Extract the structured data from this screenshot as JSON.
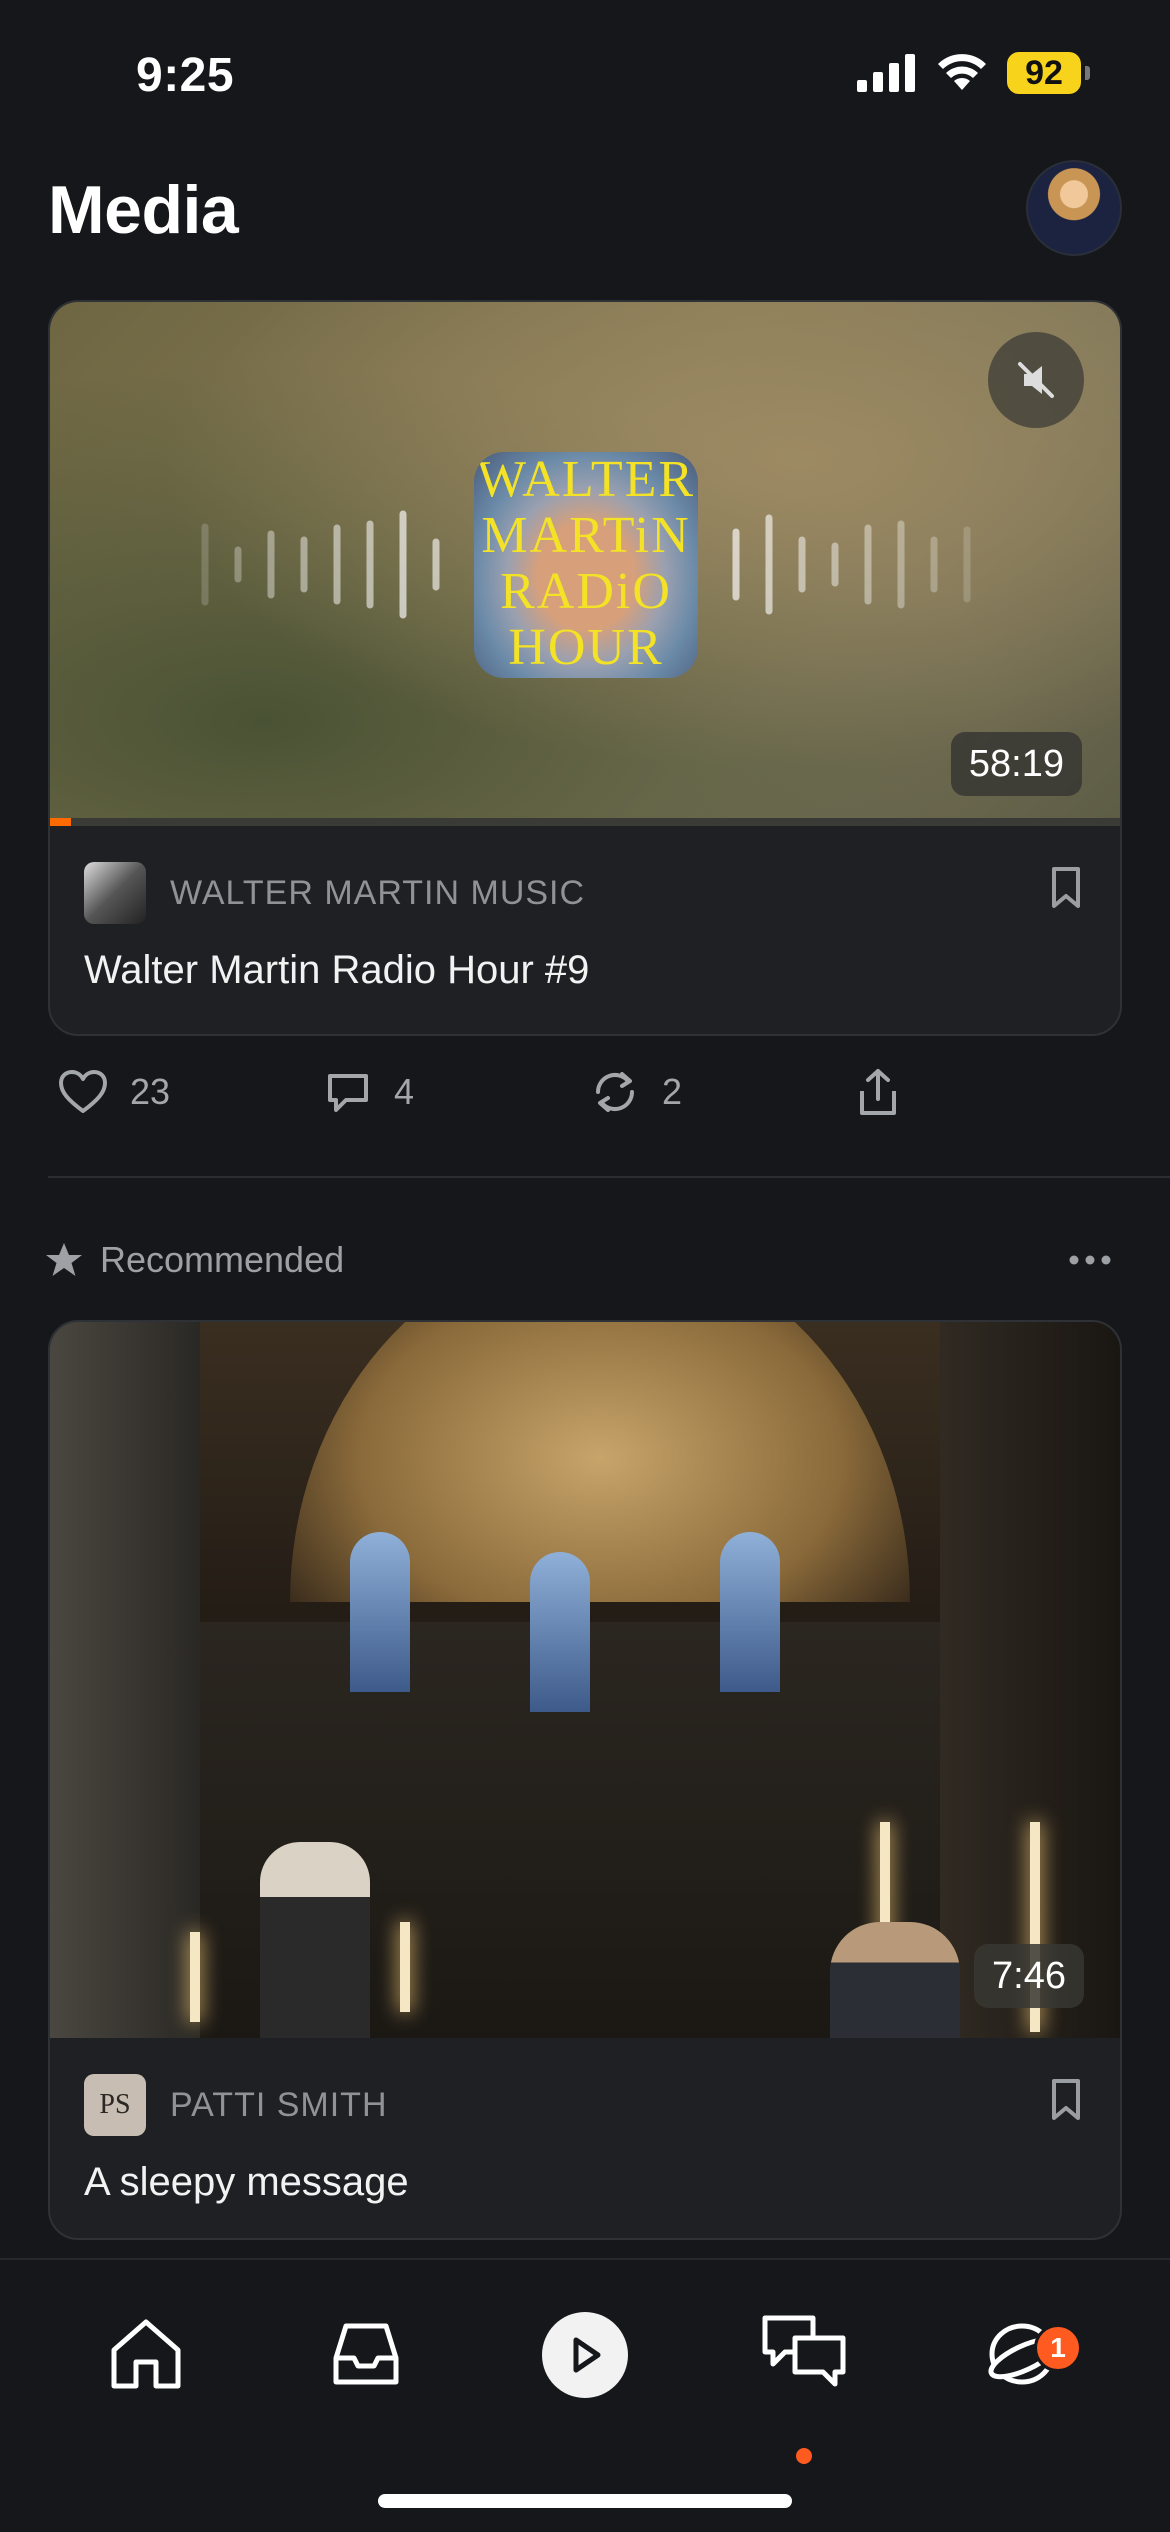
{
  "status": {
    "time": "9:25",
    "battery": "92"
  },
  "header": {
    "title": "Media"
  },
  "feed_item_1": {
    "album_text": [
      "WALTER",
      "MARTiN",
      "RADiO",
      "HOUR"
    ],
    "duration": "58:19",
    "progress_fraction": 0.02,
    "publisher": "WALTER MARTIN MUSIC",
    "title": "Walter Martin Radio Hour #9",
    "likes": "23",
    "comments": "4",
    "restacks": "2"
  },
  "section": {
    "label": "Recommended"
  },
  "feed_item_2": {
    "duration": "7:46",
    "publisher_initials": "PS",
    "publisher": "PATTI SMITH",
    "title": "A sleepy message"
  },
  "tabbar": {
    "items": [
      "home-icon",
      "inbox-icon",
      "play-icon",
      "chat-icon",
      "activity-icon"
    ],
    "notification_count": "1"
  },
  "colors": {
    "accent": "#ff6a00",
    "badge": "#ff5a1f",
    "battery": "#f7d31c"
  }
}
